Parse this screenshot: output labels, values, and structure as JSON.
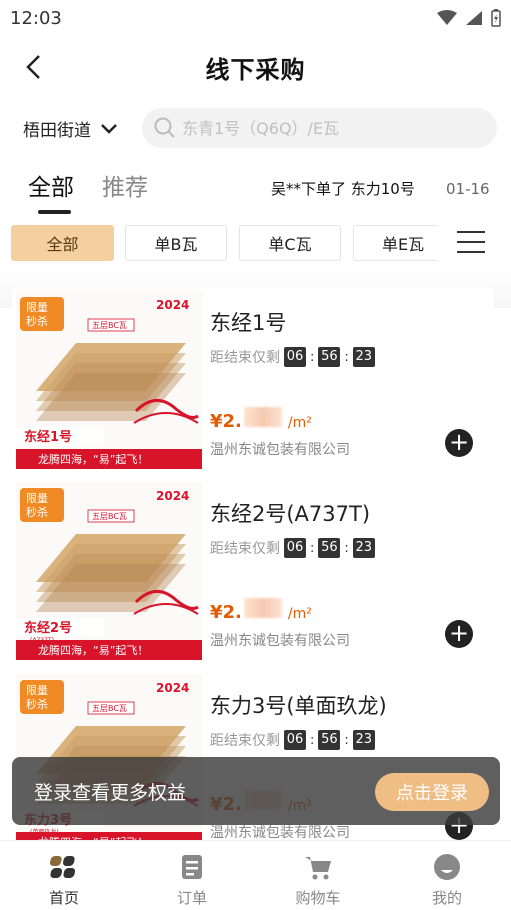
{
  "status": {
    "time": "12:03"
  },
  "header": {
    "title": "线下采购"
  },
  "location": {
    "label": "梧田街道"
  },
  "search": {
    "placeholder": "东青1号（Q6Q）/E瓦"
  },
  "tabs": [
    {
      "label": "全部"
    },
    {
      "label": "推荐"
    }
  ],
  "ticker": {
    "text": "吴**下单了 东力10号",
    "date": "01-16"
  },
  "filters": [
    {
      "label": "全部"
    },
    {
      "label": "单B瓦"
    },
    {
      "label": "单C瓦"
    },
    {
      "label": "单E瓦"
    }
  ],
  "products": [
    {
      "name": "东经1号",
      "ends_label": "距结束仅剩",
      "hh": "06",
      "mm": "56",
      "ss": "23",
      "price_prefix": "¥2.",
      "unit": "/m²",
      "company": "温州东诚包装有限公司",
      "badge": "限量秒杀",
      "tag": "东经1号",
      "tag_sub": "",
      "layers": "五层BC瓦",
      "slogan": "龙腾四海，“易”起飞！"
    },
    {
      "name": "东经2号(A737T)",
      "ends_label": "距结束仅剩",
      "hh": "06",
      "mm": "56",
      "ss": "23",
      "price_prefix": "¥2.",
      "unit": "/m²",
      "company": "温州东诚包装有限公司",
      "badge": "限量秒杀",
      "tag": "东经2号",
      "tag_sub": "(A737T)",
      "layers": "五层BC瓦",
      "slogan": "龙腾四海，“易”起飞！"
    },
    {
      "name": "东力3号(单面玖龙)",
      "ends_label": "距结束仅剩",
      "hh": "06",
      "mm": "56",
      "ss": "23",
      "price_prefix": "¥2.",
      "unit": "/m²",
      "company": "温州东诚包装有限公司",
      "badge": "限量秒杀",
      "tag": "东力3号",
      "tag_sub": "(单面玖龙)",
      "layers": "五层BC瓦",
      "slogan": "龙腾四海，“易”起飞！"
    }
  ],
  "login_bar": {
    "text": "登录查看更多权益",
    "button": "点击登录"
  },
  "tabbar": [
    {
      "label": "首页"
    },
    {
      "label": "订单"
    },
    {
      "label": "购物车"
    },
    {
      "label": "我的"
    }
  ],
  "colors": {
    "accent": "#efbe84",
    "chip_active": "#f4cfa0",
    "price": "#e35a00",
    "badge": "#f08a24",
    "banner_red": "#d7142a"
  }
}
